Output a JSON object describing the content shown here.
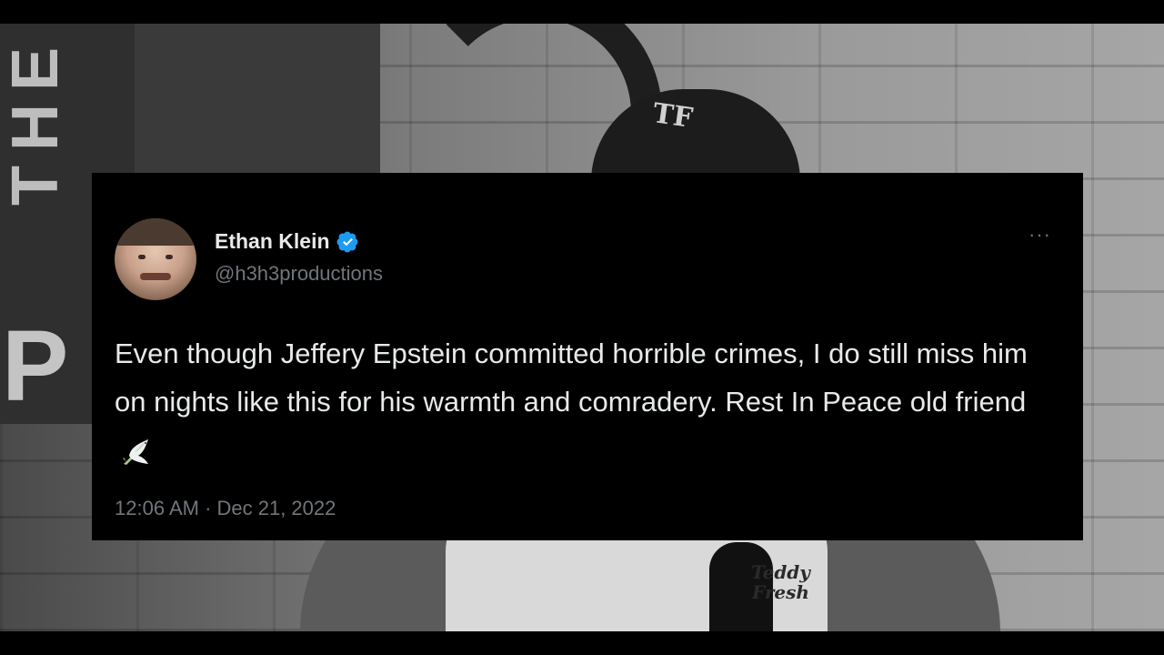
{
  "background": {
    "sign_letters": [
      "T",
      "H",
      "E"
    ],
    "sign_bottom_letter": "P",
    "cap_text": "TF",
    "shirt_text_line1": "Teddy",
    "shirt_text_line2": "Fresh"
  },
  "tweet": {
    "display_name": "Ethan Klein",
    "handle": "@h3h3productions",
    "more_label": "···",
    "text": "Even though Jeffery Epstein committed horrible crimes, I do still miss him on nights like this for his warmth and comradery. Rest In Peace old friend",
    "emoji_icon": "dove-icon",
    "timestamp": "12:06 AM · Dec 21, 2022",
    "colors": {
      "verified_blue": "#1d9bf0",
      "text_primary": "#e7e9ea",
      "text_secondary": "#71767b",
      "card_background": "#000000"
    }
  }
}
